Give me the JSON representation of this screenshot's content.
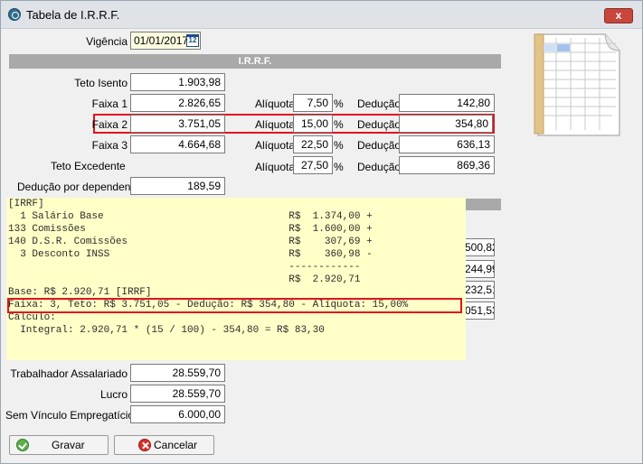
{
  "window": {
    "title": "Tabela de I.R.R.F.",
    "close_label": "x"
  },
  "vigencia": {
    "label": "Vigência",
    "value": "01/01/2017",
    "calendar_icon": "calendar-icon",
    "calendar_text": "12"
  },
  "section_title": "I.R.R.F.",
  "rows": {
    "teto_isento": {
      "label": "Teto Isento",
      "value": "1.903,98"
    },
    "faixa1": {
      "label": "Faixa 1",
      "value": "2.826,65",
      "aliquota_label": "Alíquota",
      "aliquota": "7,50",
      "pct": "%",
      "deducao_label": "Dedução",
      "deducao": "142,80"
    },
    "faixa2": {
      "label": "Faixa 2",
      "value": "3.751,05",
      "aliquota_label": "Alíquota",
      "aliquota": "15,00",
      "pct": "%",
      "deducao_label": "Dedução",
      "deducao": "354,80"
    },
    "faixa3": {
      "label": "Faixa 3",
      "value": "4.664,68",
      "aliquota_label": "Alíquota",
      "aliquota": "22,50",
      "pct": "%",
      "deducao_label": "Dedução",
      "deducao": "636,13"
    },
    "teto_excedente": {
      "label": "Teto Excedente",
      "aliquota_label": "Alíquota",
      "aliquota": "27,50",
      "pct": "%",
      "deducao_label": "Dedução",
      "deducao": "869,36"
    },
    "deducao_dependente": {
      "label": "Dedução por dependente",
      "value": "189,59"
    }
  },
  "hidden_fields": [
    "500,82",
    "244,99",
    "232,51",
    "051,53"
  ],
  "tooltip": {
    "lines": [
      "[IRRF]",
      "  1 Salário Base                               R$  1.374,00 +",
      "133 Comissões                                  R$  1.600,00 +",
      "140 D.S.R. Comissões                           R$    307,69 +",
      "  3 Desconto INSS                              R$    360,98 -",
      "                                               ------------",
      "                                               R$  2.920,71",
      "Base: R$ 2.920,71 [IRRF]",
      "Faixa: 3, Teto: R$ 3.751,05 - Dedução: R$ 354,80 - Alíquota: 15,00%",
      "Cálculo:",
      "  Integral: 2.920,71 * (15 / 100) - 354,80 = R$ 83,30"
    ]
  },
  "bottom_rows": {
    "trabalhador": {
      "label": "Trabalhador Assalariado",
      "value": "28.559,70"
    },
    "lucro": {
      "label": "Lucro",
      "value": "28.559,70"
    },
    "sem_vinculo": {
      "label": "Sem Vínculo Empregatício",
      "value": "6.000,00"
    }
  },
  "buttons": {
    "save": "Gravar",
    "cancel": "Cancelar"
  },
  "colors": {
    "highlight": "#e0141e",
    "tooltip_bg": "#ffffc8",
    "section_bar": "#a9a9a9"
  }
}
